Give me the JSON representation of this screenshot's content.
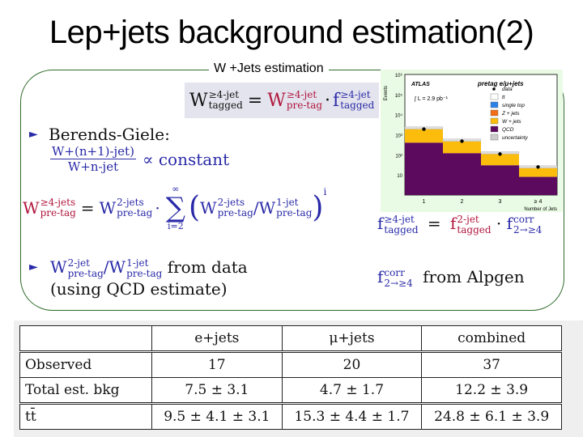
{
  "title": "Lep+jets background estimation(2)",
  "box_label": "W +Jets estimation",
  "equation_top": {
    "lhs": "W",
    "lhs_sup": "≥4-jet",
    "lhs_sub": "tagged",
    "eq": "=",
    "t1": "W",
    "t1_sup": "≥4-jet",
    "t1_sub": "pre-tag",
    "dot": "·",
    "t2": "f",
    "t2_sup": "≥4-jet",
    "t2_sub": "tagged"
  },
  "berends": {
    "label": "Berends-Giele:",
    "numerator": "W+(n+1)-jet)",
    "denominator": "W+n-jet",
    "rhs": "∝ constant"
  },
  "equation_sum": {
    "lhs": "W",
    "lhs_sup": "≥4-jets",
    "lhs_sub": "pre-tag",
    "eq": "=",
    "t1": "W",
    "t1_sup": "2-jets",
    "t1_sub": "pre-tag",
    "dot": "·",
    "sum_top": "∞",
    "sum_symbol": "∑",
    "sum_bottom": "i=2",
    "open": "(",
    "a": "W",
    "a_sup": "2-jets",
    "a_sub": "pre-tag",
    "slash": "/",
    "b": "W",
    "b_sup": "1-jet",
    "b_sub": "pre-tag",
    "close": ")",
    "power": "i"
  },
  "bullet2": {
    "a": "W",
    "a_sup": "2-jet",
    "a_sub": "pre-tag",
    "slash": "/",
    "b": "W",
    "b_sup": "1-jet",
    "b_sub": "pre-tag",
    "text": "from data",
    "line2": "(using QCD estimate)"
  },
  "equation_f": {
    "lhs": "f",
    "lhs_sup": "≥4-jet",
    "lhs_sub": "tagged",
    "eq": "=",
    "t1": "f",
    "t1_sup": "2-jet",
    "t1_sub": "tagged",
    "dot": "·",
    "t2": "f",
    "t2_sup": "corr",
    "t2_sub": "2→≥4"
  },
  "alpgen": {
    "f": "f",
    "f_sup": "corr",
    "f_sub": "2→≥4",
    "text": "from Alpgen"
  },
  "chart_data": {
    "type": "bar",
    "title": "pretag e/μ+jets",
    "experiment": "ATLAS",
    "luminosity": "∫ L = 2.9 pb⁻¹",
    "xlabel": "Number of Jets",
    "ylabel": "Events",
    "yscale": "log",
    "ylim": [
      1,
      1000000
    ],
    "ytick_labels": [
      "10",
      "10²",
      "10³",
      "10⁴",
      "10⁵",
      "10⁶"
    ],
    "categories": [
      "1",
      "2",
      "3",
      "≥ 4"
    ],
    "series": [
      {
        "name": "QCD",
        "color": "#5c0a5e",
        "values": [
          400,
          120,
          30,
          8
        ]
      },
      {
        "name": "W + jets",
        "color": "#fbbc0c",
        "values": [
          1500,
          350,
          80,
          14
        ]
      },
      {
        "name": "Z + jets",
        "color": "#f26d16",
        "values": [
          0,
          0,
          0,
          0
        ]
      },
      {
        "name": "single top",
        "color": "#2a82e8",
        "values": [
          0,
          0,
          0,
          0
        ]
      },
      {
        "name": "tt",
        "color": "#ffffff",
        "values": [
          0,
          0,
          0,
          0
        ]
      }
    ],
    "data": {
      "name": "data",
      "values": [
        1900,
        480,
        110,
        25
      ]
    },
    "legend": [
      "data",
      "tt",
      "single top",
      "Z + jets",
      "W + jets",
      "QCD",
      "uncertainty"
    ],
    "legend_position": "top-right"
  },
  "table": {
    "headers": [
      "",
      "e+jets",
      "μ+jets",
      "combined"
    ],
    "rows": [
      [
        "Observed",
        "17",
        "20",
        "37"
      ],
      [
        "Total est. bkg",
        "7.5 ± 3.1",
        "4.7 ± 1.7",
        "12.2 ± 3.9"
      ],
      [
        "tt̄",
        "9.5 ± 4.1 ± 3.1",
        "15.3 ± 4.4 ± 1.7",
        "24.8 ± 6.1 ± 3.9"
      ]
    ]
  }
}
